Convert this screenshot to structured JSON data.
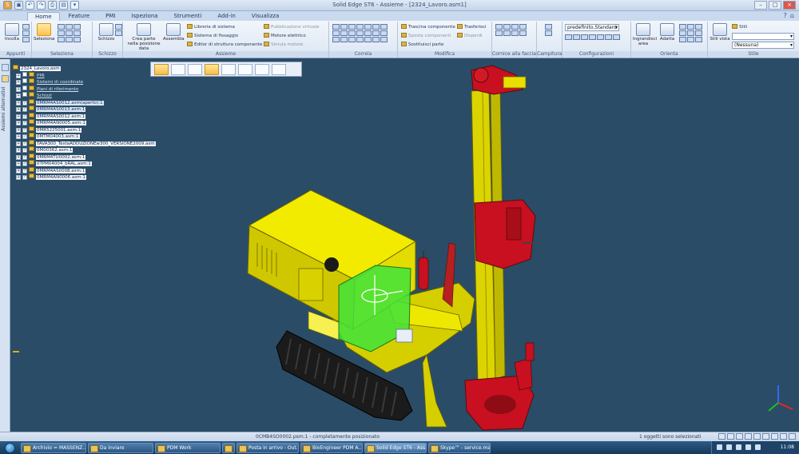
{
  "app": {
    "window_title": "Solid Edge ST6 - Assieme - [2324_Lavoro.asm1]"
  },
  "tabs": [
    "Home",
    "Feature",
    "PMI",
    "Ispeziona",
    "Strumenti",
    "Add-in",
    "Visualizza"
  ],
  "ribbon": {
    "groups": {
      "appunti": "Appunti",
      "seleziona": "Seleziona",
      "schizzo": "Schizzo",
      "assieme": "Assieme",
      "correla": "Correla",
      "modifica": "Modifica",
      "cornice": "Cornice alla faccia",
      "campitura": "Campitura",
      "configurazioni": "Configurazioni",
      "orienta": "Orienta",
      "stile": "Stile"
    },
    "buttons": {
      "incolla": "Incolla",
      "seleziona": "Seleziona",
      "schizzo": "Schizzo",
      "crea_parte": "Crea parte nella posizione data",
      "assembla": "Assembla",
      "libreria_sistema": "Libreria di sistema",
      "sistema_fissaggio": "Sistema di fissaggio",
      "editor_struttura": "Editor di struttura componente",
      "pubblicazione_virtuale": "Pubblicazione virtuale",
      "motore_elettrico": "Motore elettrico",
      "simula_motore": "Simula motore",
      "trascina_componente": "Trascina componente",
      "sposta_componenti": "Sposta componenti",
      "sostituisci_parte": "Sostituisci parte",
      "trasferisci": "Trasferisci",
      "disperdi": "Disperdi",
      "ingrandisci_area": "Ingrandisci area",
      "adatta": "Adatta",
      "stili_vista": "Stili vista",
      "stili": "Stili"
    },
    "combos": {
      "config": "predefinito,Standard",
      "stile_top": "",
      "stile_bottom": "(Nessuna)"
    }
  },
  "sidebar": {
    "label": "Assiemi alternativi"
  },
  "tree": {
    "root": "2324_Lavoro.asm",
    "items": [
      {
        "label": "PMI",
        "style": "light"
      },
      {
        "label": "Sistemi di coordinate",
        "style": "light"
      },
      {
        "label": "Piani di riferimento",
        "style": "light"
      },
      {
        "label": "Schizzi",
        "style": "light"
      },
      {
        "label": "0MRM4AS0012.asm(aperto):1",
        "style": "hl"
      },
      {
        "label": "0MRM4AS0013.asm:1",
        "style": "hl"
      },
      {
        "label": "0MRM4AS0012.asm:1",
        "style": "normal"
      },
      {
        "label": "0MRM4AN0005.asm:1",
        "style": "normal"
      },
      {
        "label": "0MR5225001.asm:1",
        "style": "normal"
      },
      {
        "label": "0MTM04003.asm:1",
        "style": "normal"
      },
      {
        "label": "TAVA300_TestaADDUZIONEw300_VERSIONE2009.asm",
        "style": "normal"
      },
      {
        "label": "0M00362.asm:1",
        "style": "normal"
      },
      {
        "label": "0MRM4TU0002.asm:1",
        "style": "normal"
      },
      {
        "label": "0TPM04004_bRAL.asm:1",
        "style": "normal"
      },
      {
        "label": "0MRM4AS0008.asm:1",
        "style": "normal"
      },
      {
        "label": "0MRM4AN0006.asm:1",
        "style": "normal"
      }
    ]
  },
  "status": {
    "message": "0CMB4SO0002.psm:1 - completamente posizionato",
    "selection": "1 oggetti sono selezionati"
  },
  "taskbar": {
    "items": [
      {
        "label": "Archivio = MASSENZ...",
        "active": false
      },
      {
        "label": "Da inviare",
        "active": false
      },
      {
        "label": "PDM Work",
        "active": false
      },
      {
        "label": "",
        "active": false
      },
      {
        "label": "Posta in arrivo - Out...",
        "active": false
      },
      {
        "label": "BioEngineer PDM A...",
        "active": false
      },
      {
        "label": "Solid Edge ST6 - Ass...",
        "active": true
      },
      {
        "label": "Skype™ - service.ma...",
        "active": false
      }
    ],
    "clock": "11:08"
  },
  "colors": {
    "viewport_bg": "#2a4c66",
    "body_yellow": "#e8e000",
    "selected_green": "#3fe33a",
    "accent_red": "#d0141c",
    "ribbon_bg": "#dbe6f3"
  }
}
